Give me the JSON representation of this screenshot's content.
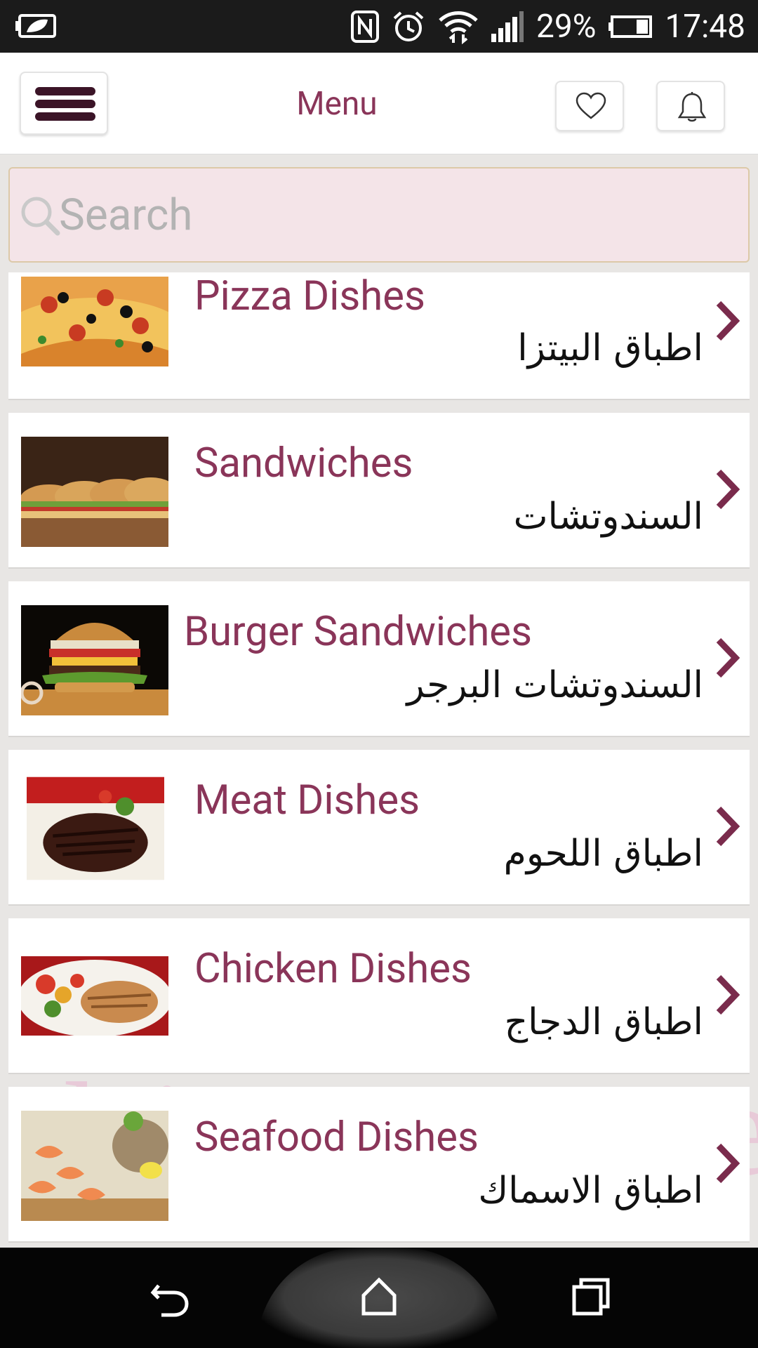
{
  "status_bar": {
    "battery": "29%",
    "time": "17:48"
  },
  "header": {
    "title": "Menu"
  },
  "search": {
    "placeholder": "Search"
  },
  "categories": [
    {
      "title_en": "Pizza Dishes",
      "title_ar": "اطباق البيتزا",
      "image": "pizza"
    },
    {
      "title_en": "Sandwiches",
      "title_ar": "السندوتشات",
      "image": "sandwiches"
    },
    {
      "title_en": "Burger Sandwiches",
      "title_ar": "السندوتشات البرجر",
      "image": "burger"
    },
    {
      "title_en": "Meat Dishes",
      "title_ar": "اطباق اللحوم",
      "image": "steak"
    },
    {
      "title_en": "Chicken Dishes",
      "title_ar": "اطباق الدجاج",
      "image": "chicken"
    },
    {
      "title_en": "Seafood Dishes",
      "title_ar": "اطباق الاسماك",
      "image": "seafood"
    }
  ],
  "colors": {
    "accent": "#8a3559",
    "menu_icon": "#3b1427",
    "search_bg": "#f4e4e8"
  }
}
